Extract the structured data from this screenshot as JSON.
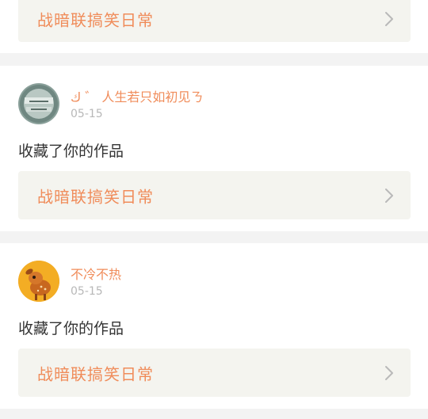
{
  "colors": {
    "accent": "#f08c5a",
    "date": "#b8b8b8",
    "text": "#333333",
    "background": "#f3f3f3",
    "work_bg": "#f4f4ef"
  },
  "top_card": {
    "work_title": "战暗联搞笑日常"
  },
  "items": [
    {
      "username": "ك ゛ 人生若只如初见ㄋ",
      "date": "05-15",
      "action": "收藏了你的作品",
      "work_title": "战暗联搞笑日常",
      "avatar_icon": "stone-avatar-icon"
    },
    {
      "username": "不冷不热",
      "date": "05-15",
      "action": "收藏了你的作品",
      "work_title": "战暗联搞笑日常",
      "avatar_icon": "fawn-avatar-icon"
    }
  ]
}
